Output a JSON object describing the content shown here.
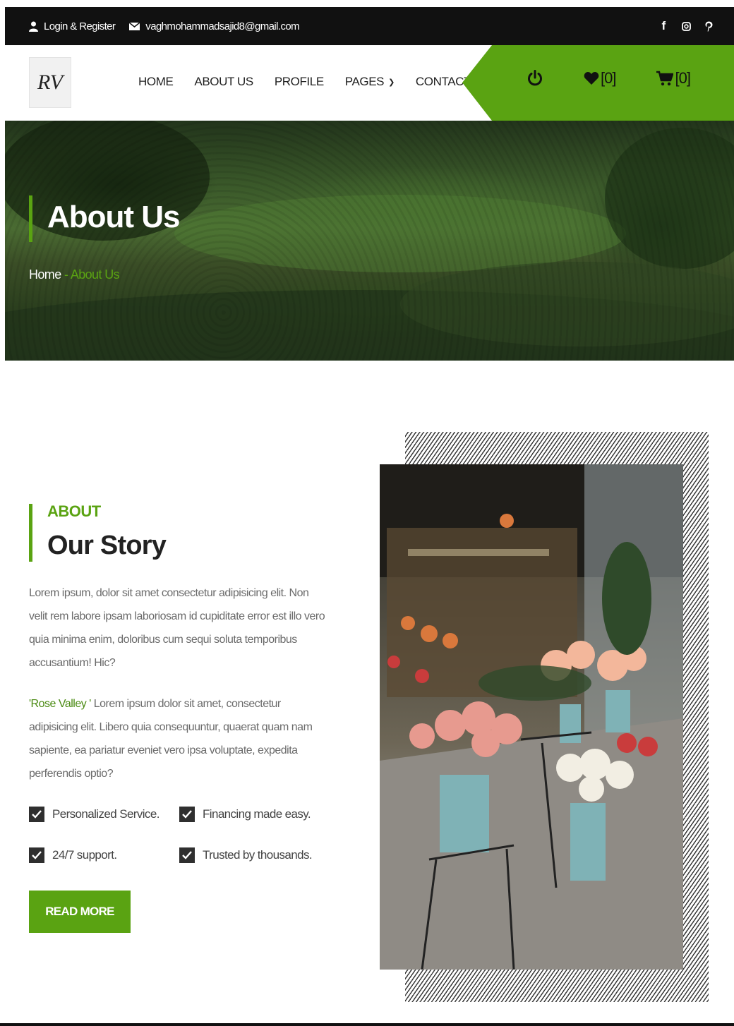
{
  "topbar": {
    "login_label": "Login & Register",
    "email": "vaghmohammadsajid8@gmail.com",
    "social_icons": [
      "facebook-icon",
      "instagram-icon",
      "pinterest-icon"
    ]
  },
  "nav": {
    "logo_text": "RV",
    "items": [
      {
        "label": "HOME"
      },
      {
        "label": "ABOUT US"
      },
      {
        "label": "PROFILE"
      },
      {
        "label": "PAGES"
      },
      {
        "label": "CONTACT"
      }
    ],
    "wishlist_count": "[0]",
    "cart_count": "[0]"
  },
  "hero": {
    "title": "About Us",
    "breadcrumb": {
      "home": "Home",
      "separator": " - ",
      "current": "About Us"
    }
  },
  "story": {
    "label": "ABOUT",
    "title": "Our Story",
    "paragraph1": "Lorem ipsum, dolor sit amet consectetur adipisicing elit. Non velit rem labore ipsam laboriosam id cupiditate error est illo vero quia minima enim, doloribus cum sequi soluta temporibus accusantium! Hic?",
    "paragraph2_brand": "'Rose Valley '",
    "paragraph2_text": " Lorem ipsum dolor sit amet, consectetur adipisicing elit. Libero quia consequuntur, quaerat quam nam sapiente, ea pariatur eveniet vero ipsa voluptate, expedita perferendis optio?",
    "features": [
      "Personalized Service.",
      "Financing made easy.",
      "24/7 support.",
      "Trusted by thousands."
    ],
    "button_label": "READ MORE"
  },
  "colors": {
    "accent": "#5aa312",
    "topbar": "#111111"
  }
}
